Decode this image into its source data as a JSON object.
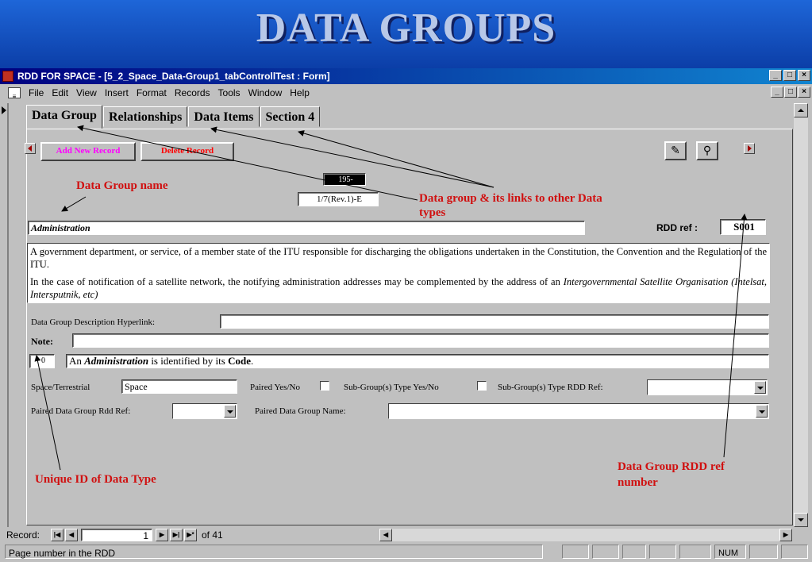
{
  "slide": {
    "title": "DATA GROUPS"
  },
  "window": {
    "title": "RDD FOR SPACE - [5_2_Space_Data-Group1_tabControllTest : Form]",
    "controls": [
      "_",
      "□",
      "×"
    ]
  },
  "menu": [
    "File",
    "Edit",
    "View",
    "Insert",
    "Format",
    "Records",
    "Tools",
    "Window",
    "Help"
  ],
  "tabs": [
    "Data Group",
    "Relationships",
    "Data Items",
    "Section 4"
  ],
  "toolbar": {
    "add_label": "Add New Record",
    "delete_label": "Delete Record",
    "add_color": "#ff00ff",
    "delete_color": "#ff0000"
  },
  "form": {
    "page_ref": "195-",
    "doc_ref": "1/7(Rev.1)-E",
    "group_name": "Administration",
    "rdd_ref_label": "RDD ref :",
    "rdd_ref_value": "S001",
    "description_p1": "A government department, or service, of a member state of the ITU responsible for discharging the obligations undertaken in the Constitution, the Convention and the Regulation of the ITU.",
    "description_p2": "In the case of notification of a satellite network, the notifying administration addresses may be complemented by the address of an",
    "description_p3": "Intergovernmental Satellite Organisation (Intelsat, Intersputnik, etc)",
    "hyperlink_label": "Data Group Description Hyperlink:",
    "hyperlink_value": "",
    "note_label": "Note:",
    "note_value": "",
    "id_value": "0",
    "identified_prefix": "An",
    "identified_entity": "Administration",
    "identified_mid": "is identified by its",
    "identified_key": "Code",
    "identified_end": ".",
    "space_label": "Space/Terrestrial",
    "space_value": "Space",
    "paired_label": "Paired Yes/No",
    "subgroup_label": "Sub-Group(s) Type Yes/No",
    "subgroup_ref_label": "Sub-Group(s) Type RDD Ref:",
    "paired_ref_label": "Paired Data Group Rdd Ref:",
    "paired_name_label": "Paired Data Group Name:"
  },
  "annotations": {
    "name": "Data Group name",
    "links": "Data group & its links to other Data",
    "links2": "types",
    "unique": "Unique ID of Data Type",
    "rdd1": "Data Group RDD  ref",
    "rdd2": "number",
    "color": "#d01010"
  },
  "record_nav": {
    "label": "Record:",
    "current": "1",
    "of_label": "of  41"
  },
  "status": {
    "text": "Page number in the RDD",
    "num": "NUM"
  }
}
